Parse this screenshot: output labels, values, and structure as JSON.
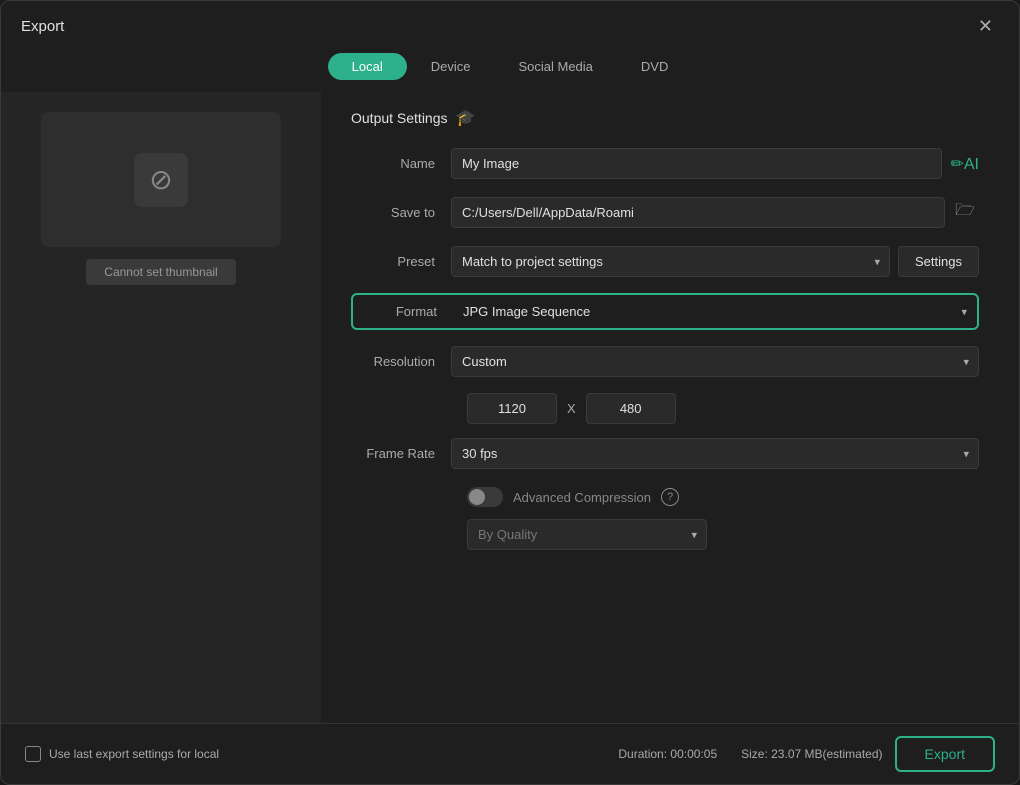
{
  "dialog": {
    "title": "Export",
    "close_label": "✕"
  },
  "tabs": {
    "items": [
      {
        "id": "local",
        "label": "Local",
        "active": true
      },
      {
        "id": "device",
        "label": "Device",
        "active": false
      },
      {
        "id": "social-media",
        "label": "Social Media",
        "active": false
      },
      {
        "id": "dvd",
        "label": "DVD",
        "active": false
      }
    ]
  },
  "thumbnail": {
    "cannot_set_label": "Cannot set thumbnail"
  },
  "output_settings": {
    "title": "Output Settings",
    "name_label": "Name",
    "name_value": "My Image",
    "save_to_label": "Save to",
    "save_to_value": "C:/Users/Dell/AppData/Roami",
    "preset_label": "Preset",
    "preset_value": "Match to project settings",
    "settings_btn_label": "Settings",
    "format_label": "Format",
    "format_value": "JPG Image Sequence",
    "resolution_label": "Resolution",
    "resolution_value": "Custom",
    "res_width": "1120",
    "res_x_label": "X",
    "res_height": "480",
    "frame_rate_label": "Frame Rate",
    "frame_rate_value": "30 fps",
    "advanced_compression_label": "Advanced Compression",
    "by_quality_label": "By Quality"
  },
  "footer": {
    "use_last_label": "Use last export settings for local",
    "duration_label": "Duration: 00:00:05",
    "size_label": "Size: 23.07 MB(estimated)",
    "export_btn_label": "Export"
  },
  "icons": {
    "close": "✕",
    "grad_hat": "🎓",
    "ai": "✏AI",
    "folder": "🗁",
    "chevron_down": "▾",
    "help": "?",
    "no_symbol": "⊘"
  }
}
